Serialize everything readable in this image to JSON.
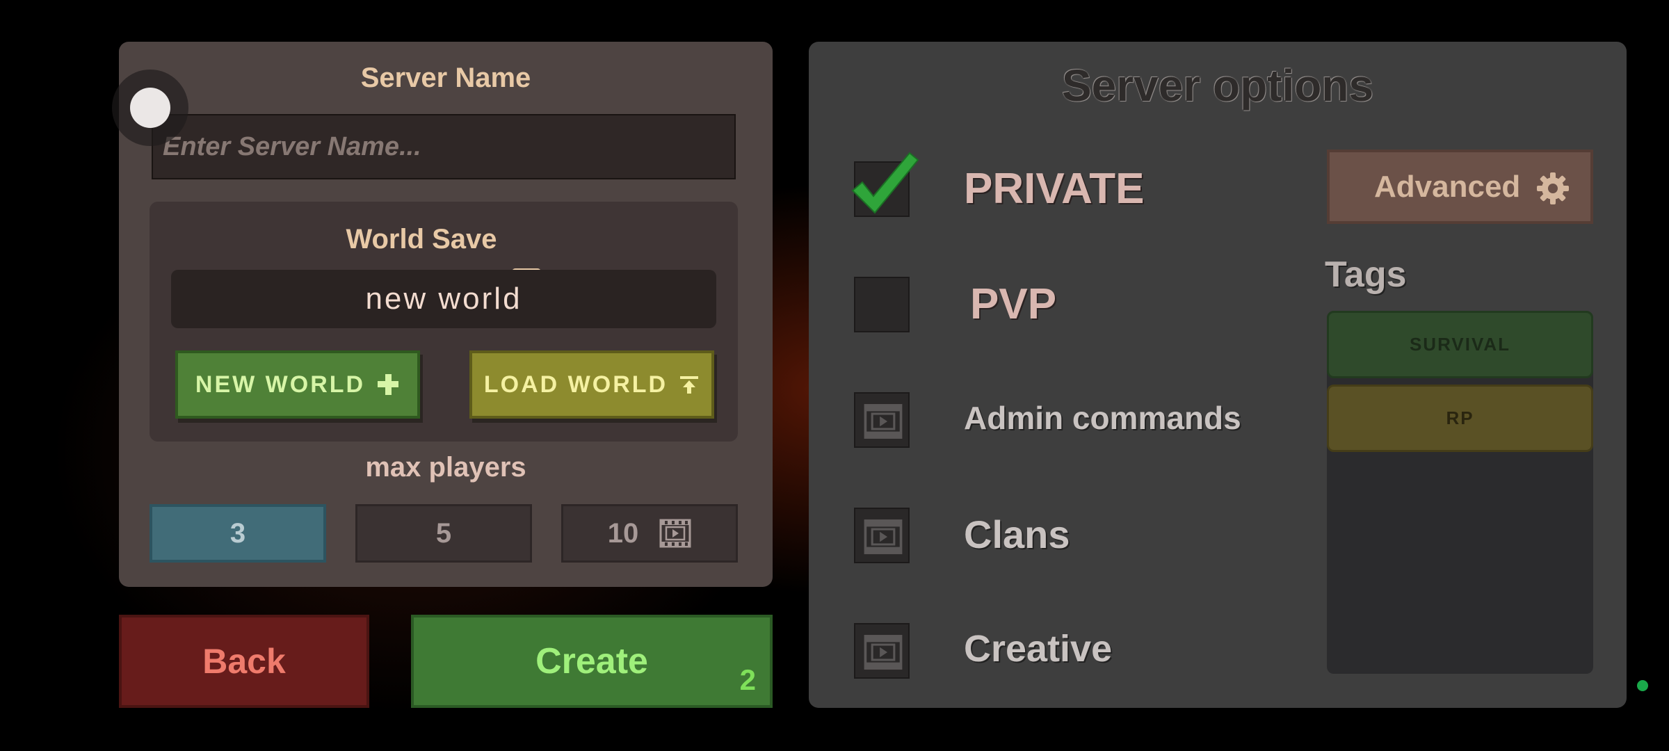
{
  "server_name": {
    "title": "Server Name",
    "placeholder": "Enter Server Name...",
    "value": ""
  },
  "world_save": {
    "title": "World Save",
    "icon": "floppy-disk-icon",
    "current_world": "new world",
    "new_world_label": "NEW WORLD",
    "new_world_icon": "plus-icon",
    "load_world_label": "LOAD WORLD",
    "load_world_icon": "upload-icon"
  },
  "max_players": {
    "title": "max players",
    "options": [
      "3",
      "5",
      "10"
    ],
    "selected": "3",
    "ad_icon": "film-icon"
  },
  "actions": {
    "back_label": "Back",
    "create_label": "Create",
    "create_badge": "2"
  },
  "server_options": {
    "title": "Server options",
    "private_label": "PRIVATE",
    "private_checked": true,
    "pvp_label": "PVP",
    "pvp_checked": false,
    "admin_label": "Admin commands",
    "clans_label": "Clans",
    "creative_label": "Creative",
    "locked_icon": "film-icon",
    "advanced_label": "Advanced",
    "advanced_icon": "gear-icon",
    "tags_title": "Tags",
    "tags": [
      "SURVIVAL",
      "RP"
    ]
  },
  "colors": {
    "selected_option": "#416c78",
    "create": "#3f7a34",
    "back": "#671c1b",
    "check": "#2fa53a"
  }
}
